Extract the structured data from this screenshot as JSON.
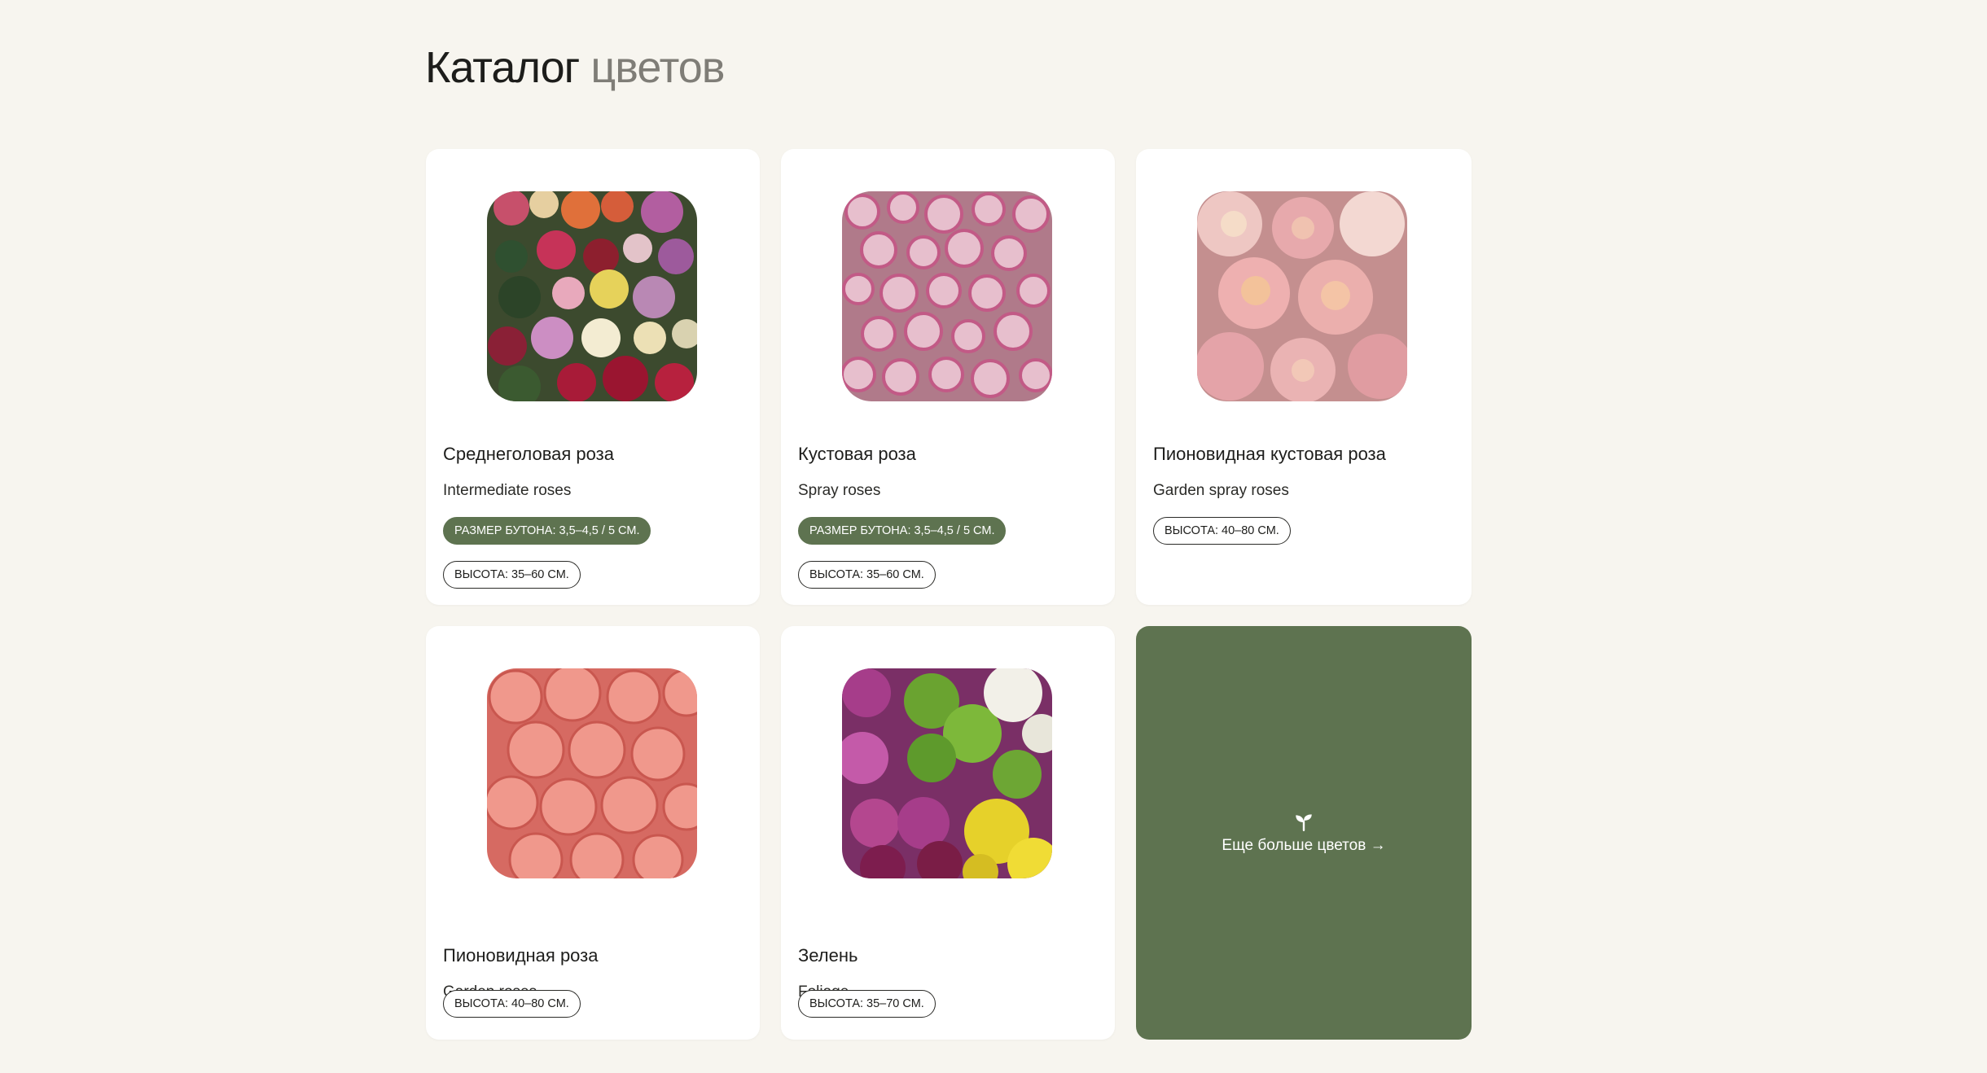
{
  "heading": {
    "main": "Каталог",
    "accent": "цветов"
  },
  "colors": {
    "background": "#f7f5ef",
    "card": "#ffffff",
    "accent_green": "#5e7350",
    "muted_text": "#7f7d77"
  },
  "cards": [
    {
      "name": "Среднеголовая роза",
      "latin": "Intermediate roses",
      "image": "mixed-roses-photo",
      "tags": [
        {
          "text": "РАЗМЕР БУТОНА: 3,5–4,5 / 5 СМ.",
          "style": "filled"
        },
        {
          "text": "ВЫСОТА: 35–60 СМ.",
          "style": "outline"
        }
      ]
    },
    {
      "name": "Кустовая роза",
      "latin": "Spray roses",
      "image": "pink-spray-roses-photo",
      "tags": [
        {
          "text": "РАЗМЕР БУТОНА: 3,5–4,5 / 5 СМ.",
          "style": "filled"
        },
        {
          "text": "ВЫСОТА: 35–60 СМ.",
          "style": "outline"
        }
      ]
    },
    {
      "name": "Пионовидная кустовая роза",
      "latin": "Garden spray roses",
      "image": "peony-spray-roses-photo",
      "tags": [
        {
          "text": "ВЫСОТА: 40–80 СМ.",
          "style": "outline"
        }
      ]
    },
    {
      "name": "Пионовидная роза",
      "latin": "Garden roses",
      "image": "coral-garden-roses-photo",
      "tags": [
        {
          "text": "ВЫСОТА: 40–80 СМ.",
          "style": "outline"
        }
      ]
    },
    {
      "name": "Зелень",
      "latin": "Foliage",
      "image": "chrysanthemums-foliage-photo",
      "tags": [
        {
          "text": "ВЫСОТА: 35–70 СМ.",
          "style": "outline"
        }
      ]
    }
  ],
  "more": {
    "label": "Еще больше цветов →",
    "icon": "sprout-icon"
  }
}
